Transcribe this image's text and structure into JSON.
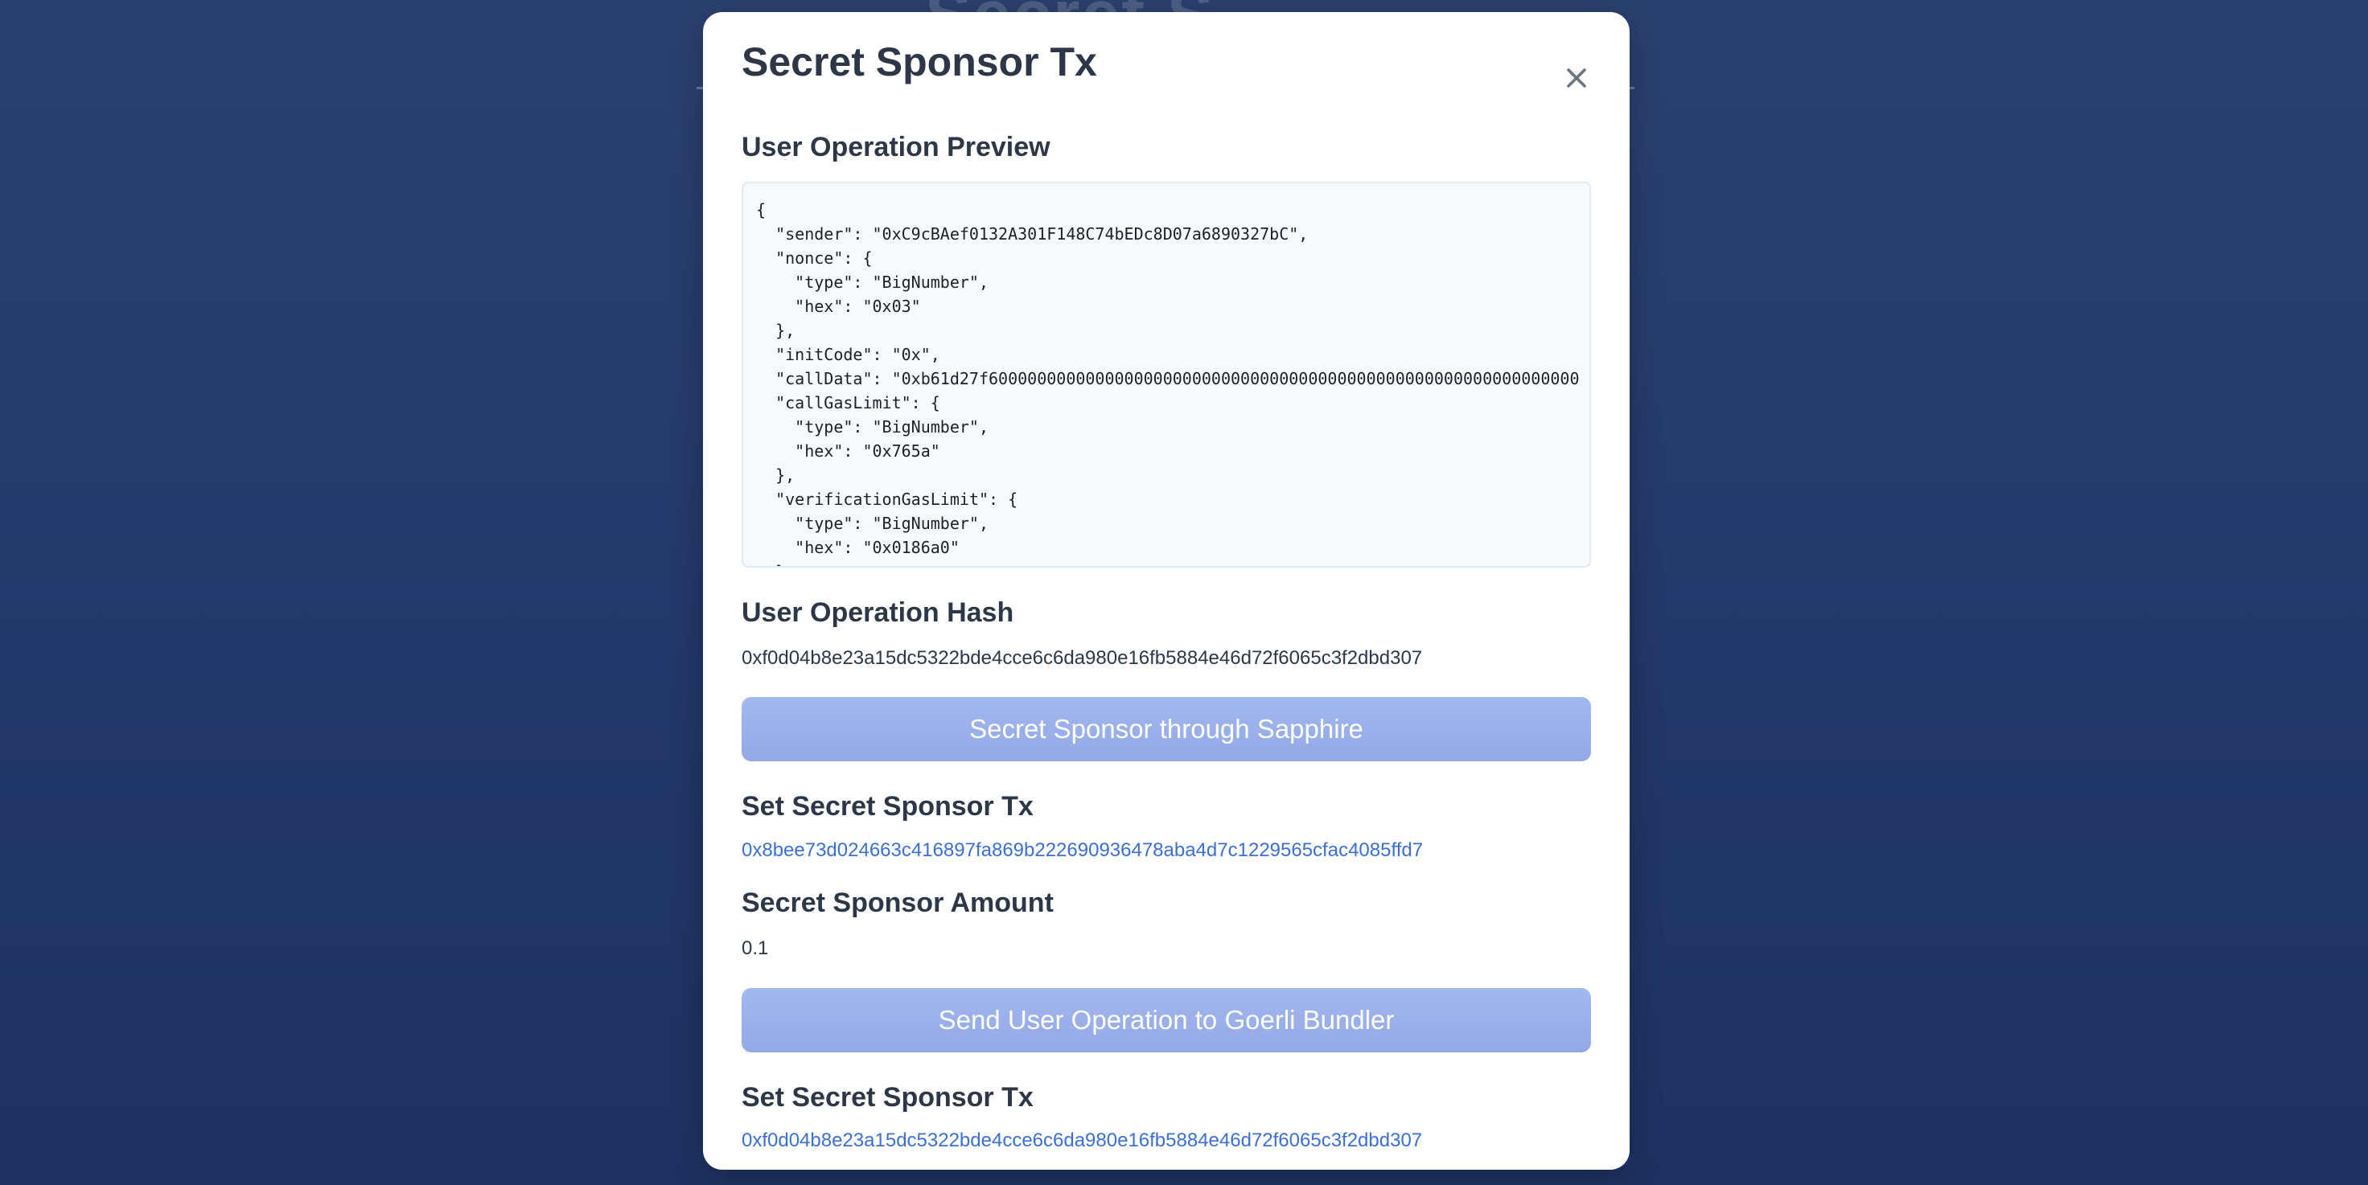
{
  "background": {
    "title": "Secret S"
  },
  "modal": {
    "title": "Secret Sponsor Tx",
    "close_icon": "close-icon"
  },
  "preview": {
    "label": "User Operation Preview",
    "code": "{\n  \"sender\": \"0xC9cBAef0132A301F148C74bEDc8D07a6890327bC\",\n  \"nonce\": {\n    \"type\": \"BigNumber\",\n    \"hex\": \"0x03\"\n  },\n  \"initCode\": \"0x\",\n  \"callData\": \"0xb61d27f6000000000000000000000000000000000000000000000000000000000000\n  \"callGasLimit\": {\n    \"type\": \"BigNumber\",\n    \"hex\": \"0x765a\"\n  },\n  \"verificationGasLimit\": {\n    \"type\": \"BigNumber\",\n    \"hex\": \"0x0186a0\"\n  },"
  },
  "hash": {
    "label": "User Operation Hash",
    "value": "0xf0d04b8e23a15dc5322bde4cce6c6da980e16fb5884e46d72f6065c3f2dbd307"
  },
  "sponsor_button": {
    "label": "Secret Sponsor through Sapphire"
  },
  "set_tx": {
    "label": "Set Secret Sponsor Tx",
    "value": "0x8bee73d024663c416897fa869b222690936478aba4d7c1229565cfac4085ffd7"
  },
  "amount": {
    "label": "Secret Sponsor Amount",
    "value": "0.1"
  },
  "send_button": {
    "label": "Send User Operation to Goerli Bundler"
  },
  "bundler_tx": {
    "label": "Set Secret Sponsor Tx",
    "value": "0xf0d04b8e23a15dc5322bde4cce6c6da980e16fb5884e46d72f6065c3f2dbd307"
  },
  "colors": {
    "background": "#263d72",
    "button": "#9bb0eb",
    "link": "#3b6fd4",
    "heading": "#2d3748"
  }
}
